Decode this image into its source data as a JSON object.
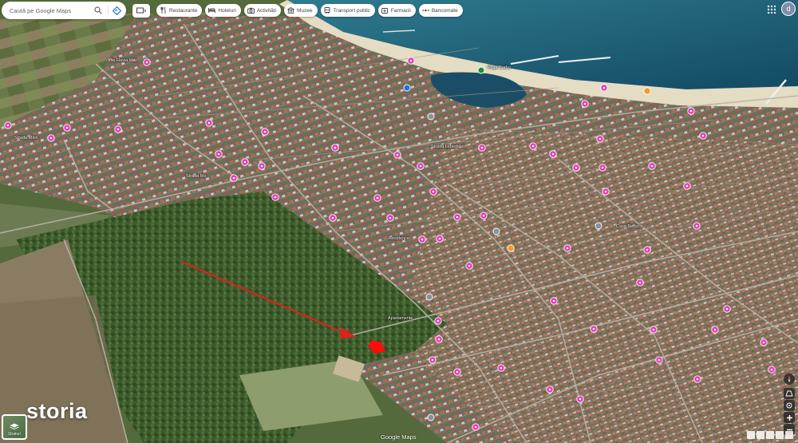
{
  "search": {
    "placeholder": "Caută pe Google Maps"
  },
  "chips": [
    {
      "label": "Restaurante",
      "icon": "fork-knife-icon"
    },
    {
      "label": "Hoteluri",
      "icon": "bed-icon"
    },
    {
      "label": "Activități",
      "icon": "camera-icon"
    },
    {
      "label": "Muzee",
      "icon": "museum-icon"
    },
    {
      "label": "Transport public",
      "icon": "bus-icon"
    },
    {
      "label": "Farmacii",
      "icon": "pharmacy-icon"
    },
    {
      "label": "Bancomate",
      "icon": "atm-icon"
    }
  ],
  "account": {
    "initial": "d"
  },
  "map_labels": {
    "villa": "Vila Flavia Mar",
    "beach": "Plaja Corbu",
    "street_left": "Strada Mării",
    "street_center": "Strada Lebedelor",
    "guesthouse": "Casa Bellucci",
    "street_west": "Strada Mo",
    "residence": "Residence",
    "apartments": "Apartamente"
  },
  "layers_button": {
    "label": "Straturi"
  },
  "brand": {
    "name": "storia"
  },
  "attribution": {
    "text": "Google Maps"
  },
  "colors": {
    "sea": "#1d5f78",
    "sand": "#e5dcc4",
    "pin_pink": "#e23bb8",
    "pin_orange": "#f29b2a",
    "arrow_red": "#e0201b",
    "plot_red": "#ff0b0b"
  }
}
